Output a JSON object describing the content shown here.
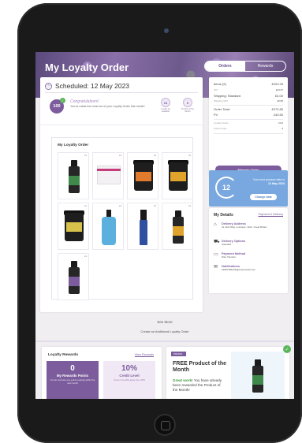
{
  "header": {
    "title": "My Loyalty Order",
    "tabs": [
      "Orders",
      "Rewards"
    ]
  },
  "schedule": {
    "title": "Scheduled: 12 May 2023",
    "points_badge": "100",
    "congrats_title": "Congratulations!",
    "congrats_text": "You've made the most out of your Loyalty Order this month!",
    "stats": [
      {
        "top": "",
        "value": "24",
        "label": "Loyalty pts available"
      },
      {
        "top": "",
        "value": "0",
        "label": "Product of the Month"
      }
    ],
    "order_box_title": "My Loyalty Order",
    "products": [
      {
        "qty": "x1",
        "kind": "bottle",
        "label_color": "#3f8a4a"
      },
      {
        "qty": "x1",
        "kind": "kit",
        "label_color": "#c43c7a"
      },
      {
        "qty": "x1",
        "kind": "jar",
        "label_color": "#e07a2c"
      },
      {
        "qty": "x1",
        "kind": "jar",
        "label_color": "#e0a42c"
      },
      {
        "qty": "x1",
        "kind": "jar",
        "label_color": "#d6c24a"
      },
      {
        "qty": "x1",
        "kind": "pump",
        "label_color": "#5bb0de"
      },
      {
        "qty": "x1",
        "kind": "roller",
        "label_color": "#2f4fa0"
      },
      {
        "qty": "x1",
        "kind": "bottle",
        "label_color": "#e0a42c"
      },
      {
        "qty": "x1",
        "kind": "bottle",
        "label_color": "#7c5c9c"
      }
    ],
    "see_more": "See More",
    "create_link": "Create an Additional Loyalty Order"
  },
  "summary": {
    "rows": [
      {
        "label": "Items (9)",
        "value": "£223.33",
        "small": false
      },
      {
        "label": "VAT",
        "value": "£44.67",
        "small": true
      },
      {
        "label": "Shipping: Standard",
        "value": "£4.00",
        "small": false
      },
      {
        "label": "Shipping VAT",
        "value": "£0.80",
        "small": true
      },
      {
        "label": "Order Total:",
        "value": "£272.80",
        "small": false
      },
      {
        "label": "PV",
        "value": "240.50",
        "small": false
      },
      {
        "label": "Loyalty Points",
        "value": "24.0",
        "small": true
      },
      {
        "label": "Points Used",
        "value": "0",
        "small": true
      }
    ],
    "manage_button": "Manage Order"
  },
  "process": {
    "day": "12",
    "text": "Your next process date is",
    "date": "12 May 2023",
    "change_button": "Change date"
  },
  "details": {
    "title": "My Details",
    "link": "Payment & Delivery",
    "rows": [
      {
        "icon": "home-icon",
        "glyph": "⌂",
        "label": "Delivery Address",
        "value": "1a Jack Way, Leicester, LE11, Great Britain"
      },
      {
        "icon": "truck-icon",
        "glyph": "⛟",
        "label": "Delivery Options",
        "value": "Standard"
      },
      {
        "icon": "card-icon",
        "glyph": "▭",
        "label": "Payment Method",
        "value": "Wire Transfer"
      },
      {
        "icon": "mail-icon",
        "glyph": "✉",
        "label": "Notifications",
        "value": "01897384223@doterramail.com"
      }
    ]
  },
  "rewards": {
    "title": "Loyalty Rewards",
    "link": "View Rewards",
    "points": {
      "value": "0",
      "label": "My Rewards Points",
      "sub": "You do not have any points expiring within the next month"
    },
    "credit": {
      "value": "10%",
      "label": "Credit Level",
      "sub": "You're 3 months away from 15%"
    }
  },
  "promo": {
    "tag": "PROMO",
    "title": "FREE Product of the Month",
    "text_green": "Great work!",
    "text_rest": " You have already been rewarded the Product of the Month!"
  },
  "colors": {
    "accent": "#7c5c9c",
    "process_blue": "#78a8df",
    "success_green": "#5bb65b"
  }
}
